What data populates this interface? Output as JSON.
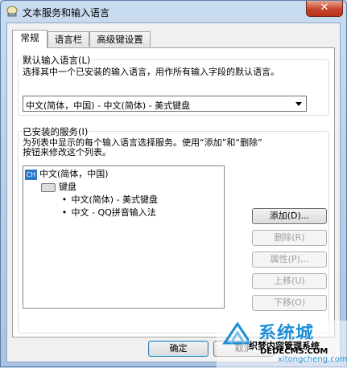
{
  "window": {
    "title": "文本服务和输入语言",
    "close_label": "✕"
  },
  "tabs": [
    {
      "label": "常规",
      "active": true
    },
    {
      "label": "语言栏",
      "active": false
    },
    {
      "label": "高级键设置",
      "active": false
    }
  ],
  "default_language": {
    "group_label": "默认输入语言(L)",
    "description": "选择其中一个已安装的输入语言，用作所有输入字段的默认语言。",
    "selected": "中文(简体，中国) - 中文(简体) - 美式键盘"
  },
  "installed_services": {
    "group_label": "已安装的服务(I)",
    "description_line1": "为列表中显示的每个输入语言选择服务。使用“添加”和“删除”",
    "description_line2": "按钮来修改这个列表。",
    "tree": {
      "language_code": "CH",
      "language": "中文(简体，中国)",
      "category": "键盘",
      "items": [
        "中文(简体) - 美式键盘",
        "中文 - QQ拼音输入法"
      ]
    },
    "buttons": {
      "add": "添加(D)...",
      "remove": "删除(R)",
      "properties": "属性(P)...",
      "move_up": "上移(U)",
      "move_down": "下移(O)"
    }
  },
  "footer": {
    "ok": "确定",
    "cancel": "取消"
  },
  "watermark": {
    "brand": "系统城",
    "site_text": "织梦内容管理系统",
    "site_url": "DEDECMS.COM",
    "url": "xitongcheng.com"
  },
  "colors": {
    "titlebar": "#bcd3ea",
    "close_button": "#c7452e",
    "accent": "#2b78c7",
    "watermark": "#1f8fd6"
  },
  "icons": {
    "title": "keyboard-lang-icon",
    "language": "ch-language-icon",
    "category": "keyboard-icon"
  }
}
